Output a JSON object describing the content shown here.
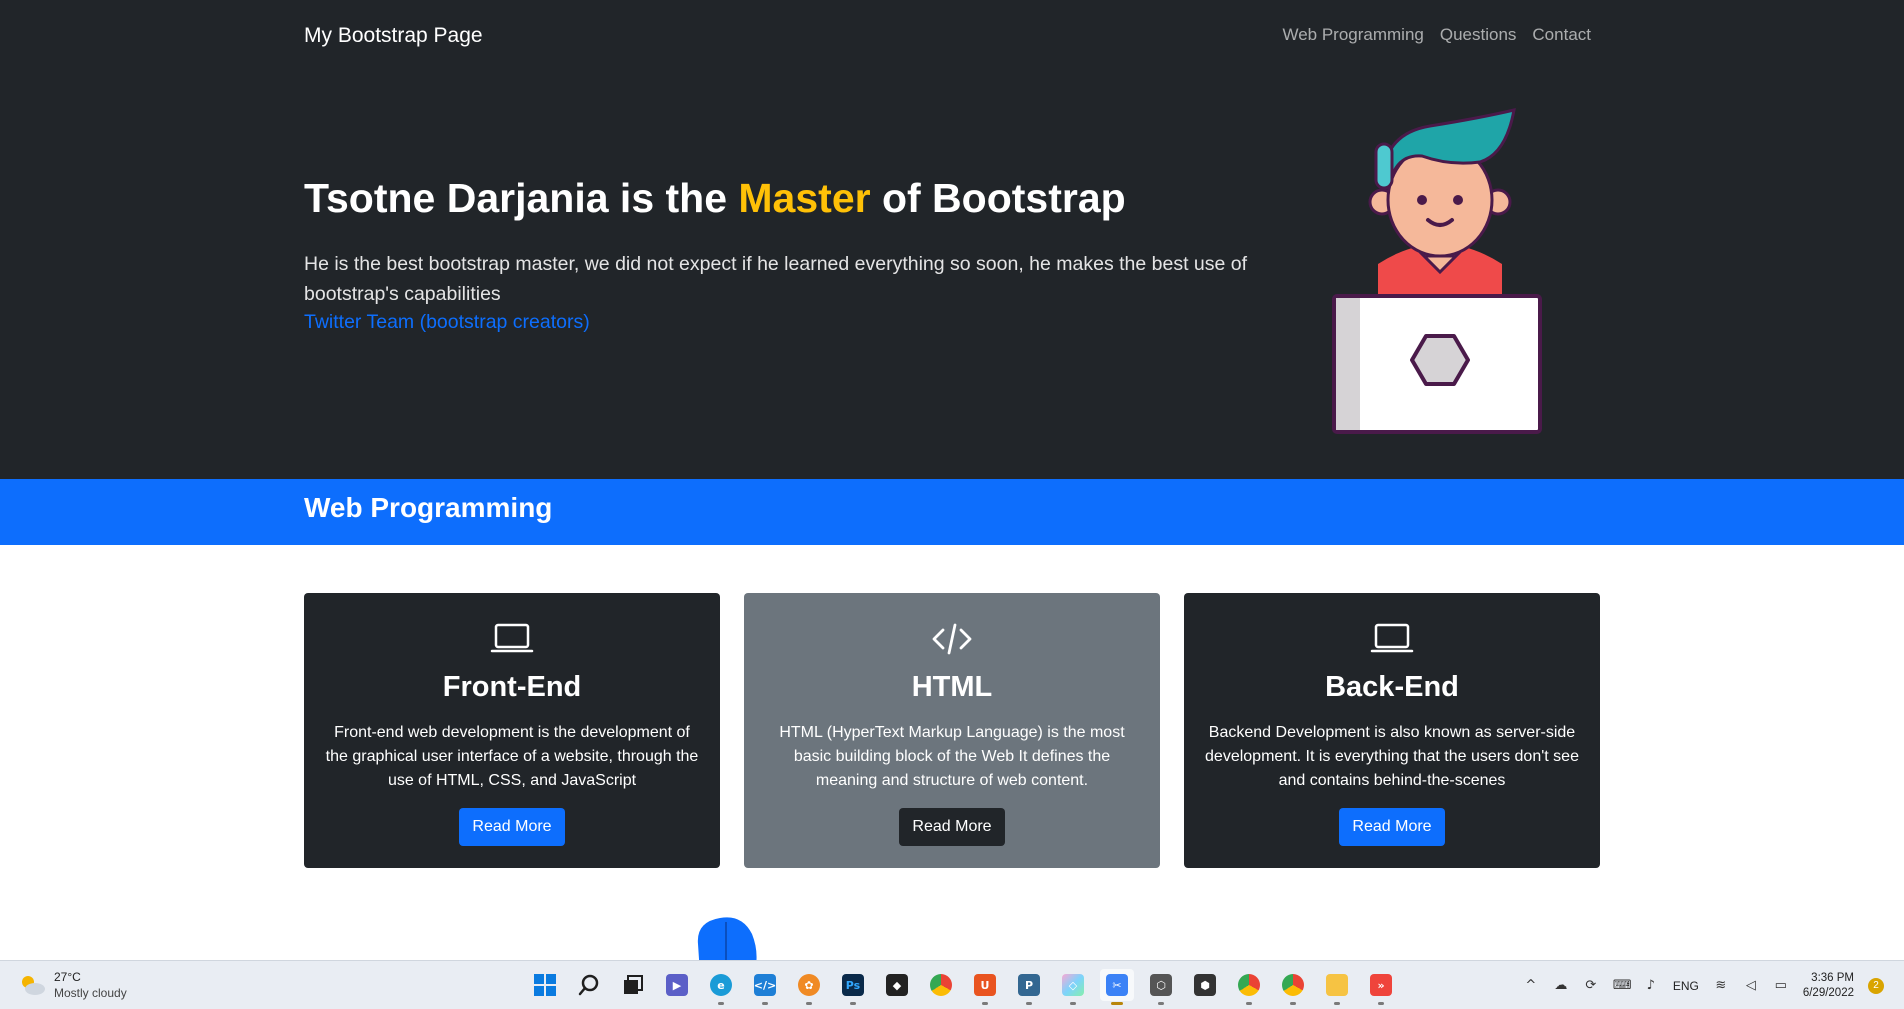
{
  "navbar": {
    "brand": "My Bootstrap Page",
    "links": [
      "Web Programming",
      "Questions",
      "Contact"
    ]
  },
  "hero": {
    "title_before": "Tsotne Darjania is the ",
    "title_accent": "Master",
    "title_after": " of Bootstrap",
    "text": "He is the best bootstrap master, we did not expect if he learned everything so soon, he makes the best use of bootstrap's capabilities",
    "link": "Twitter Team (bootstrap creators)"
  },
  "section": {
    "title": "Web Programming"
  },
  "cards": [
    {
      "icon": "laptop-icon",
      "title": "Front-End",
      "text": "Front-end web development is the development of the graphical user interface of a website, through the use of HTML, CSS, and JavaScript",
      "button": "Read More"
    },
    {
      "icon": "code-slash-icon",
      "title": "HTML",
      "text": "HTML (HyperText Markup Language) is the most basic building block of the Web It defines the meaning and structure of web content.",
      "button": "Read More"
    },
    {
      "icon": "laptop-icon",
      "title": "Back-End",
      "text": "Backend Development is also known as server-side development. It is everything that the users don't see and contains behind-the-scenes",
      "button": "Read More"
    }
  ],
  "colors": {
    "dark": "#212529",
    "primary": "#0d6efd",
    "secondary": "#6c757d",
    "warning": "#ffc107"
  },
  "taskbar": {
    "weather_temp": "27°C",
    "weather_condition": "Mostly cloudy",
    "apps": [
      "windows-start-icon",
      "search-icon",
      "task-view-icon",
      "chat-icon",
      "edge-icon",
      "vscode-icon",
      "fl-studio-icon",
      "photoshop-icon",
      "unity-icon",
      "chrome-icon",
      "ubuntu-icon",
      "postgresql-icon",
      "sourcetree-icon",
      "snipping-tool-icon",
      "unity-hub-icon",
      "blender-icon",
      "chrome-profile-icon",
      "chrome-profile-icon",
      "file-explorer-icon",
      "anydesk-icon"
    ],
    "language": "ENG",
    "time": "3:36 PM",
    "date": "6/29/2022",
    "notifications": "2"
  }
}
